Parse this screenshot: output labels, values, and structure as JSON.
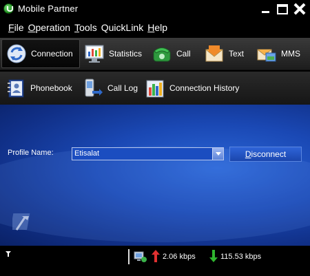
{
  "window": {
    "title": "Mobile Partner"
  },
  "menu": {
    "items": [
      {
        "first": "F",
        "rest": "ile"
      },
      {
        "first": "O",
        "rest": "peration"
      },
      {
        "first": "T",
        "rest": "ools"
      },
      {
        "first": "",
        "rest": "QuickLink"
      },
      {
        "first": "H",
        "rest": "elp"
      }
    ]
  },
  "toolbar": {
    "row1": [
      {
        "label": "Connection",
        "icon": "connection-icon",
        "active": true
      },
      {
        "label": "Statistics",
        "icon": "statistics-icon"
      },
      {
        "label": "Call",
        "icon": "phone-icon"
      },
      {
        "label": "Text",
        "icon": "envelope-icon"
      },
      {
        "label": "MMS",
        "icon": "mms-icon"
      }
    ],
    "row2": [
      {
        "label": "Phonebook",
        "icon": "phonebook-icon"
      },
      {
        "label": "Call Log",
        "icon": "call-log-icon"
      },
      {
        "label": "Connection History",
        "icon": "connection-history-icon"
      }
    ]
  },
  "profile": {
    "label": "Profile Name:",
    "selected": "Etisalat",
    "button_first": "D",
    "button_rest": "isconnect"
  },
  "status": {
    "upload": "2.06 kbps",
    "download": "115.53 kbps"
  },
  "colors": {
    "accent_blue": "#1a48b4",
    "upload_arrow": "#e03030",
    "download_arrow": "#2fb52f"
  }
}
